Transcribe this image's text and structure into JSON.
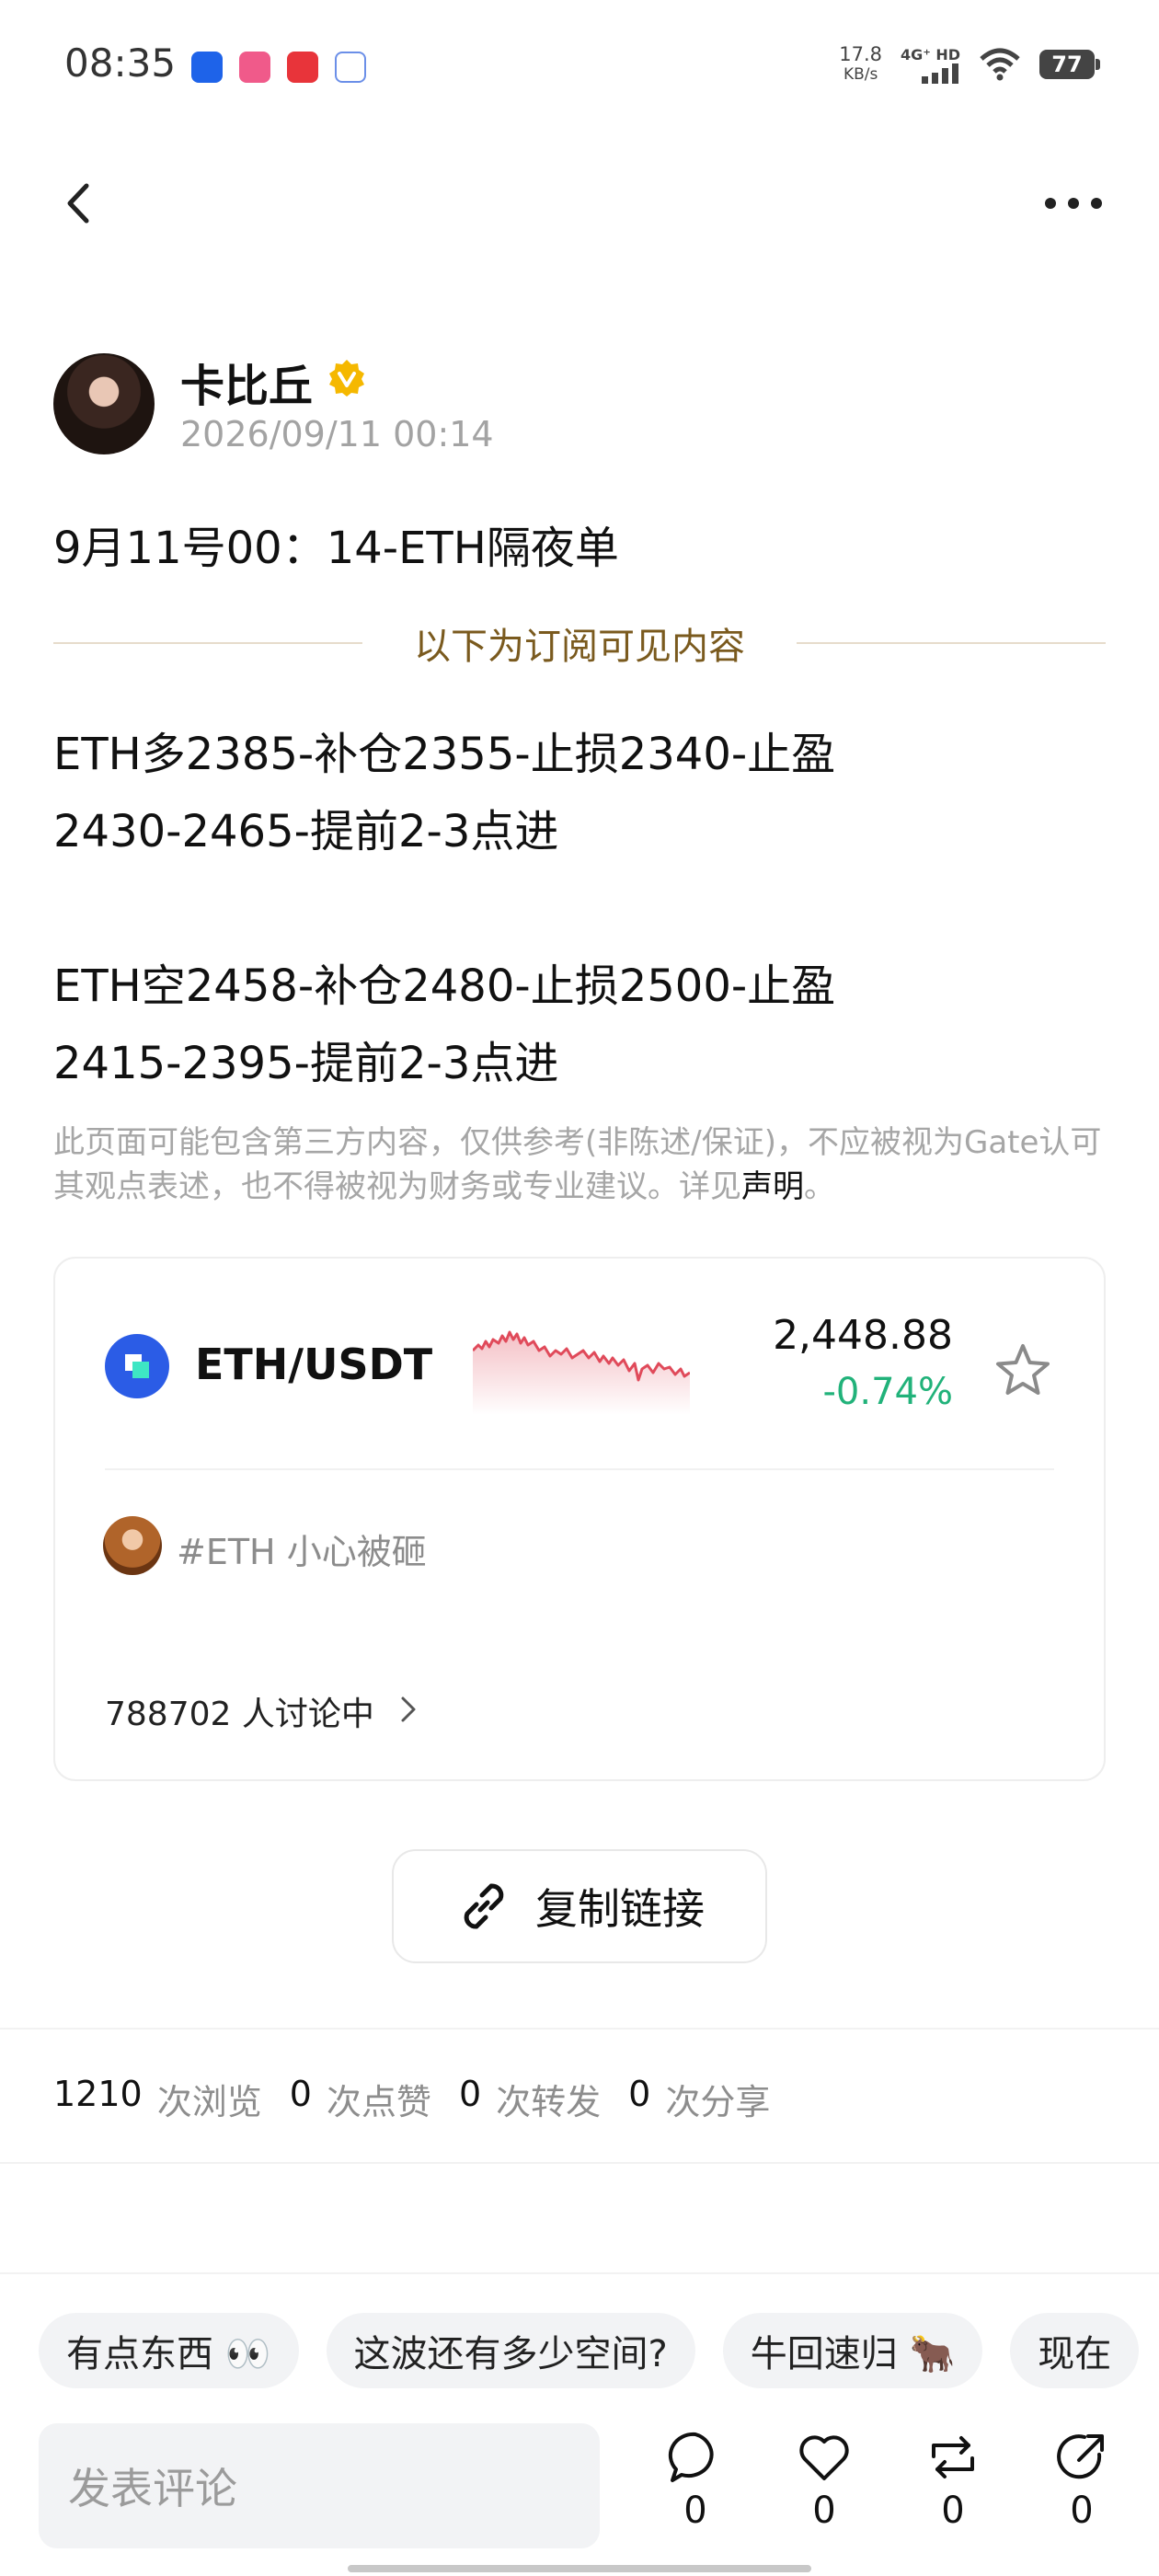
{
  "status_bar": {
    "time": "08:35",
    "net_speed_value": "17.8",
    "net_speed_unit": "KB/s",
    "network": "4G⁺ HD",
    "battery": "77"
  },
  "author": {
    "name": "卡比丘",
    "timestamp": "2026/09/11 00:14"
  },
  "post": {
    "title": "9月11号00：14-ETH隔夜单",
    "subscriber_divider": "以下为订阅可见内容",
    "body": "ETH多2385-补仓2355-止损2340-止盈\n2430-2465-提前2-3点进\n\nETH空2458-补仓2480-止损2500-止盈\n2415-2395-提前2-3点进",
    "disclaimer": "此页面可能包含第三方内容，仅供参考(非陈述/保证)，不应被视为Gate认可其观点表述，也不得被视为财务或专业建议。详见",
    "disclaimer_link": "声明",
    "disclaimer_end": "。"
  },
  "ticker": {
    "pair": "ETH/USDT",
    "price": "2,448.88",
    "change": "-0.74%",
    "topic": "#ETH 小心被砸",
    "discussion": "788702 人讨论中"
  },
  "copy_link_label": "复制链接",
  "stats": [
    {
      "num": "1210",
      "label": "次浏览"
    },
    {
      "num": "0",
      "label": "次点赞"
    },
    {
      "num": "0",
      "label": "次转发"
    },
    {
      "num": "0",
      "label": "次分享"
    }
  ],
  "quick_replies": [
    "有点东西 👀",
    "这波还有多少空间?",
    "牛回速归 🐂",
    "现在"
  ],
  "comment": {
    "placeholder": "发表评论",
    "comment_count": "0",
    "like_count": "0",
    "repost_count": "0",
    "share_count": "0"
  },
  "colors": {
    "negative": "#21b27a",
    "sparkline": "#e04a5a",
    "accent_gold": "#f5b800",
    "coin_blue": "#2b5ce6"
  }
}
